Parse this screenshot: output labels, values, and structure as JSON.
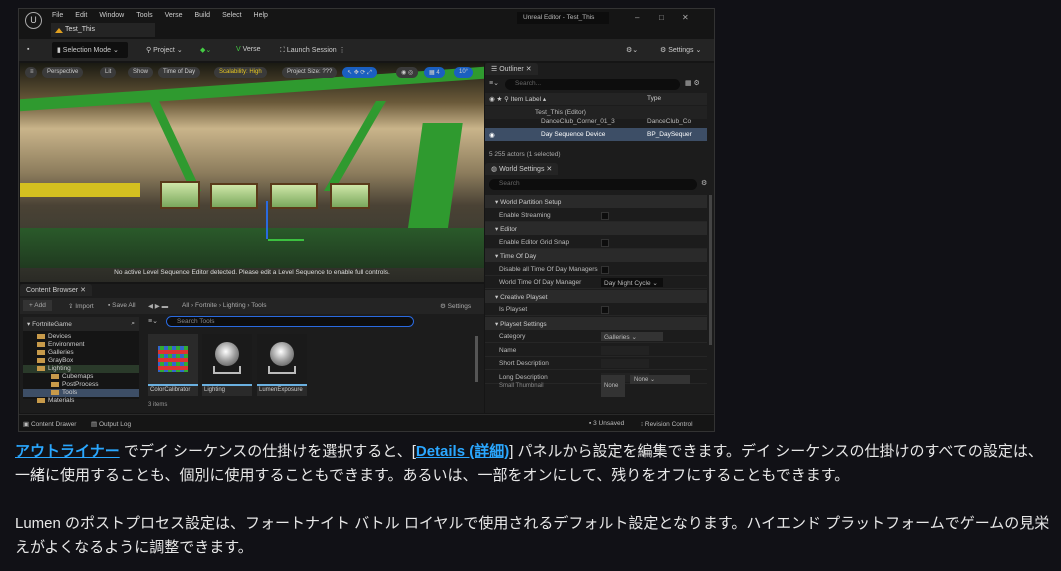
{
  "editor": {
    "menu": [
      "File",
      "Edit",
      "Window",
      "Tools",
      "Verse",
      "Build",
      "Select",
      "Help"
    ],
    "doc_tab": "Test_This",
    "window_title": "Unreal Editor - Test_This",
    "toolbar": {
      "selection_mode": "Selection Mode",
      "project": "Project",
      "verse": "Verse",
      "launch_session": "Launch Session",
      "settings": "Settings"
    },
    "viewport": {
      "perspective": "Perspective",
      "lit": "Lit",
      "show": "Show",
      "time_of_day": "Time of Day",
      "scalability": "Scalability: High",
      "project_size": "Project Size: ???",
      "snap_value": "4",
      "angle_value": "10°",
      "message": "No active Level Sequence Editor detected. Please edit a Level Sequence to enable full controls."
    },
    "outliner": {
      "tab": "Outliner",
      "search_placeholder": "Search...",
      "col_label": "Item Label",
      "col_type": "Type",
      "rows": [
        {
          "label": "Test_This (Editor)",
          "type": ""
        },
        {
          "label": "DanceClub_Corner_01_3",
          "type": "DanceClub_Co"
        },
        {
          "label": "Day Sequence Device",
          "type": "BP_DaySequer"
        }
      ],
      "status": "5 255 actors (1 selected)"
    },
    "world_settings": {
      "tab": "World Settings",
      "search_placeholder": "Search",
      "rows": [
        {
          "kind": "section",
          "label": "World Partition Setup"
        },
        {
          "kind": "check",
          "label": "Enable Streaming"
        },
        {
          "kind": "section",
          "label": "Editor"
        },
        {
          "kind": "check",
          "label": "Enable Editor Grid Snap"
        },
        {
          "kind": "section",
          "label": "Time Of Day"
        },
        {
          "kind": "check",
          "label": "Disable all Time Of Day Managers"
        },
        {
          "kind": "dropdown",
          "label": "World Time Of Day Manager",
          "value": "Day Night Cycle"
        },
        {
          "kind": "section",
          "label": "Creative Playset"
        },
        {
          "kind": "check",
          "label": "Is Playset"
        },
        {
          "kind": "section",
          "label": "Playset Settings"
        },
        {
          "kind": "dropdown",
          "label": "Category",
          "value": "Galleries"
        },
        {
          "kind": "text",
          "label": "Name"
        },
        {
          "kind": "text",
          "label": "Short Description"
        },
        {
          "kind": "text",
          "label": "Long Description"
        }
      ],
      "thumbnail_label": "Small Thumbnail",
      "thumbnail_none": "None",
      "thumbnail_select": "None"
    },
    "content_browser": {
      "tab": "Content Browser",
      "add": "Add",
      "import": "Import",
      "save_all": "Save All",
      "path": [
        "All",
        "Fortnite",
        "Lighting",
        "Tools"
      ],
      "settings": "Settings",
      "root": "FortniteGame",
      "folders": [
        {
          "name": "Devices",
          "indent": 1
        },
        {
          "name": "Environment",
          "indent": 1
        },
        {
          "name": "Galleries",
          "indent": 1
        },
        {
          "name": "GrayBox",
          "indent": 1
        },
        {
          "name": "Lighting",
          "indent": 1
        },
        {
          "name": "Cubemaps",
          "indent": 2
        },
        {
          "name": "PostProcess",
          "indent": 2
        },
        {
          "name": "Tools",
          "indent": 2
        },
        {
          "name": "Materials",
          "indent": 1
        }
      ],
      "search_placeholder": "Search Tools",
      "assets": [
        "ColorCalibrator",
        "Lighting",
        "LumenExposure"
      ],
      "item_count": "3 items"
    },
    "statusbar": {
      "content_drawer": "Content Drawer",
      "output_log": "Output Log",
      "unsaved": "3 Unsaved",
      "revision_control": "Revision Control"
    }
  },
  "article": {
    "p1": {
      "link1": "アウトライナー",
      "t1": " でデイ シーケンスの仕掛けを選択すると、[",
      "link2": "Details (詳細)",
      "t2": "] パネルから設定を編集できます。デイ シーケンスの仕掛けのすべての設定は、一緒に使用することも、個別に使用することもできます。あるいは、一部をオンにして、残りをオフにすることもできます。"
    },
    "p2": "Lumen のポストプロセス設定は、フォートナイト バトル ロイヤルで使用されるデフォルト設定となります。ハイエンド プラットフォームでゲームの見栄えがよくなるように調整できます。"
  }
}
